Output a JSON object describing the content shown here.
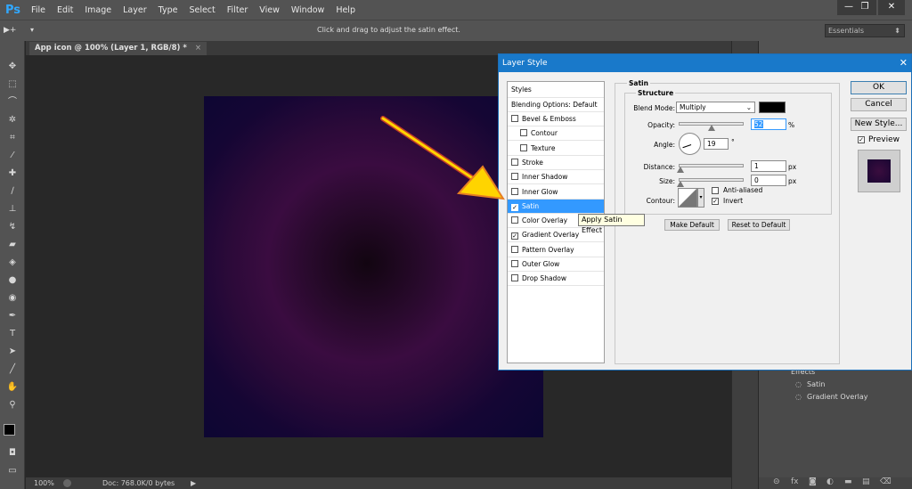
{
  "app": {
    "logo": "Ps"
  },
  "menu": [
    "File",
    "Edit",
    "Image",
    "Layer",
    "Type",
    "Select",
    "Filter",
    "View",
    "Window",
    "Help"
  ],
  "window_controls": {
    "minimize": "—",
    "restore": "❐",
    "close": "✕"
  },
  "options_bar": {
    "tool_glyph": "▶+",
    "dropdown": "▾",
    "hint": "Click and drag to adjust the satin effect.",
    "workspace": "Essentials"
  },
  "document": {
    "tab_title": "App icon @ 100% (Layer 1, RGB/8) *",
    "tab_close": "×"
  },
  "status_bar": {
    "zoom": "100%",
    "doc_info": "Doc: 768.0K/0 bytes",
    "arrow": "▶"
  },
  "dialog": {
    "title": "Layer Style",
    "close": "✕",
    "styles_header": "Styles",
    "blending_options": "Blending Options: Default",
    "style_items": [
      {
        "label": "Bevel & Emboss",
        "checked": false,
        "indent": false,
        "selected": false
      },
      {
        "label": "Contour",
        "checked": false,
        "indent": true,
        "selected": false
      },
      {
        "label": "Texture",
        "checked": false,
        "indent": true,
        "selected": false
      },
      {
        "label": "Stroke",
        "checked": false,
        "indent": false,
        "selected": false
      },
      {
        "label": "Inner Shadow",
        "checked": false,
        "indent": false,
        "selected": false
      },
      {
        "label": "Inner Glow",
        "checked": false,
        "indent": false,
        "selected": false
      },
      {
        "label": "Satin",
        "checked": true,
        "indent": false,
        "selected": true
      },
      {
        "label": "Color Overlay",
        "checked": false,
        "indent": false,
        "selected": false
      },
      {
        "label": "Gradient Overlay",
        "checked": true,
        "indent": false,
        "selected": false
      },
      {
        "label": "Pattern Overlay",
        "checked": false,
        "indent": false,
        "selected": false
      },
      {
        "label": "Outer Glow",
        "checked": false,
        "indent": false,
        "selected": false
      },
      {
        "label": "Drop Shadow",
        "checked": false,
        "indent": false,
        "selected": false
      }
    ],
    "satin": {
      "group_title": "Satin",
      "structure_title": "Structure",
      "blend_mode_label": "Blend Mode:",
      "blend_mode_value": "Multiply",
      "blend_color": "#000000",
      "opacity_label": "Opacity:",
      "opacity_value": "52",
      "opacity_unit": "%",
      "angle_label": "Angle:",
      "angle_value": "19",
      "angle_unit": "°",
      "distance_label": "Distance:",
      "distance_value": "1",
      "distance_unit": "px",
      "size_label": "Size:",
      "size_value": "0",
      "size_unit": "px",
      "contour_label": "Contour:",
      "anti_aliased_label": "Anti-aliased",
      "anti_aliased_checked": false,
      "invert_label": "Invert",
      "invert_checked": true,
      "make_default": "Make Default",
      "reset_default": "Reset to Default"
    },
    "buttons": {
      "ok": "OK",
      "cancel": "Cancel",
      "new_style": "New Style...",
      "preview": "Preview",
      "preview_checked": true
    }
  },
  "tooltip": "Apply Satin Effect",
  "layers_panel": {
    "effects": "Effects",
    "effect_items": [
      "Satin",
      "Gradient Overlay"
    ]
  },
  "colors": {
    "accent": "#1979ca",
    "selection": "#3399ff",
    "arrow": "#ffd400"
  }
}
